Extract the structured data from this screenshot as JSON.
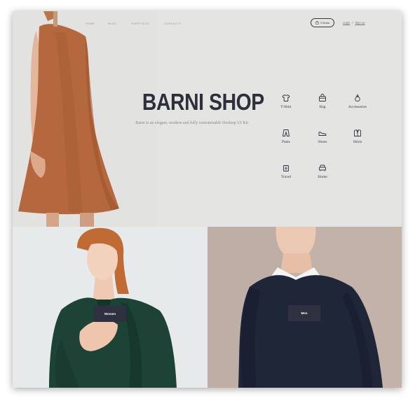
{
  "nav": {
    "items": [
      {
        "label": "Home",
        "active": true
      },
      {
        "label": "Blog",
        "active": false
      },
      {
        "label": "Portfolio",
        "active": false
      },
      {
        "label": "Contacts",
        "active": false
      }
    ]
  },
  "cart": {
    "label": "2 Items",
    "icon": "bag-icon"
  },
  "auth": {
    "login": "Login",
    "separator": "/",
    "signup": "Sign up"
  },
  "hero": {
    "title": "BARNI SHOP",
    "subtitle": "Barni is an elegant, modern and fully customizable Desktop UI Kit"
  },
  "categories": [
    {
      "label": "T-Shirt",
      "icon": "tshirt-icon"
    },
    {
      "label": "Bag",
      "icon": "bag-icon"
    },
    {
      "label": "Accessories",
      "icon": "ring-icon"
    },
    {
      "label": "Pants",
      "icon": "pants-icon"
    },
    {
      "label": "Shoes",
      "icon": "shoe-icon"
    },
    {
      "label": "Shirts",
      "icon": "shirt-icon"
    },
    {
      "label": "Travel",
      "icon": "luggage-icon"
    },
    {
      "label": "Home",
      "icon": "armchair-icon"
    }
  ],
  "tiles": {
    "women": {
      "button": "Women"
    },
    "men": {
      "button": "Men"
    }
  },
  "colors": {
    "accent_dark": "#2f3140",
    "title": "#2d2f3b",
    "hero_bg": "#e4e4e3",
    "dress": "#b5683d",
    "women_coat": "#1d4236",
    "men_sweater": "#1f2638",
    "men_bg": "#bfaea6"
  }
}
